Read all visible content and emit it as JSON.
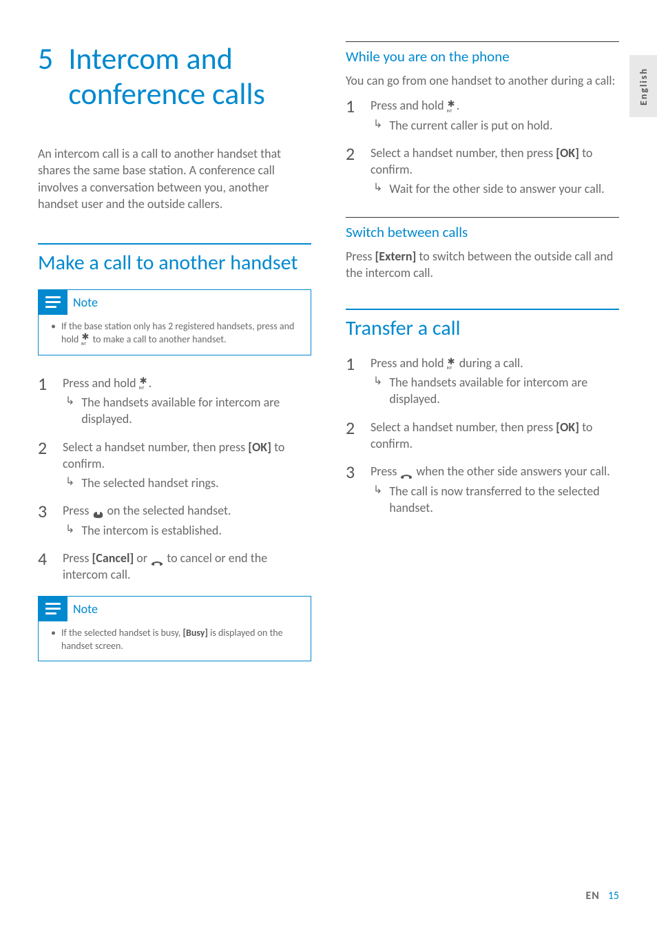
{
  "sideTab": "English",
  "chapter": {
    "num": "5",
    "title": "Intercom and conference calls"
  },
  "intro": "An intercom call is a call to another handset that shares the same base station. A conference call involves a conversation between you, another handset user and the outside callers.",
  "section1": {
    "heading": "Make a call to another handset",
    "note1": {
      "label": "Note",
      "text_a": "If the base station only has 2 registered handsets, press and hold ",
      "text_b": " to make a call to another handset."
    },
    "steps": {
      "s1_a": "Press and hold ",
      "s1_b": ".",
      "s1_res": "The handsets available for intercom are displayed.",
      "s2_a": "Select a handset number, then press ",
      "s2_ok": "[OK]",
      "s2_b": " to confirm.",
      "s2_res": "The selected handset rings.",
      "s3_a": "Press ",
      "s3_b": " on the selected handset.",
      "s3_res": "The intercom is established.",
      "s4_a": "Press ",
      "s4_cancel": "[Cancel]",
      "s4_b": " or ",
      "s4_c": " to cancel or end the intercom call."
    },
    "note2": {
      "label": "Note",
      "text_a": "If the selected handset is busy, ",
      "text_busy": "[Busy]",
      "text_b": " is displayed on the handset screen."
    }
  },
  "section2": {
    "sub1": {
      "heading": "While you are on the phone",
      "para": "You can go from one handset to another during a call:",
      "s1_a": "Press and hold ",
      "s1_b": ".",
      "s1_res": "The current caller is put on hold.",
      "s2_a": "Select a handset number, then press ",
      "s2_ok": "[OK]",
      "s2_b": " to confirm.",
      "s2_res": "Wait for the other side to answer your call."
    },
    "sub2": {
      "heading": "Switch between calls",
      "para_a": "Press ",
      "para_ext": "[Extern]",
      "para_b": " to switch between the outside call and the intercom call."
    }
  },
  "section3": {
    "heading": "Transfer a call",
    "s1_a": "Press and hold ",
    "s1_b": " during a call.",
    "s1_res": "The handsets available for intercom are displayed.",
    "s2_a": "Select a handset number, then press ",
    "s2_ok": "[OK]",
    "s2_b": " to confirm.",
    "s3_a": "Press ",
    "s3_b": " when the other side answers your call.",
    "s3_res": "The call is now transferred to the selected handset."
  },
  "footer": {
    "lang": "EN",
    "page": "15"
  }
}
